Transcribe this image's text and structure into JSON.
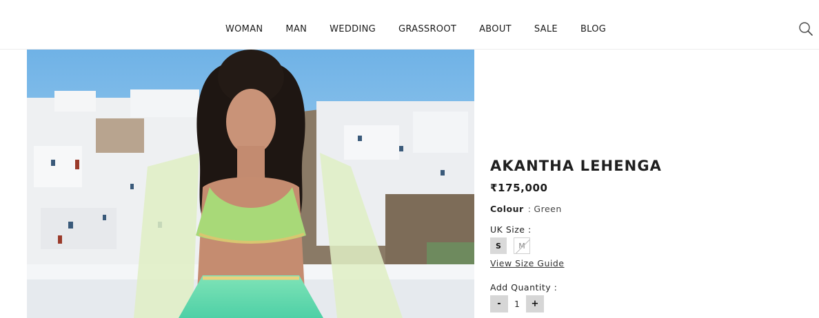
{
  "nav": {
    "items": [
      "WOMAN",
      "MAN",
      "WEDDING",
      "GRASSROOT",
      "ABOUT",
      "SALE",
      "BLOG"
    ],
    "search_icon": "search-icon"
  },
  "product": {
    "title": "AKANTHA LEHENGA",
    "price": "₹175,000",
    "colour_label": "Colour",
    "colour_sep": ":",
    "colour_value": "Green",
    "size_label": "UK Size :",
    "sizes": [
      {
        "label": "S",
        "available": true
      },
      {
        "label": "M",
        "available": false
      }
    ],
    "size_guide_link": "View Size Guide",
    "quantity_label": "Add Quantity :",
    "quantity_minus": "-",
    "quantity_value": "1",
    "quantity_plus": "+"
  },
  "colors": {
    "text": "#1f1f1f",
    "size_button_bg": "#d9d9d9",
    "quantity_button_bg": "#d6d6d6",
    "sky": "#8fc3ea",
    "lehenga_green": "#8fe0b4"
  }
}
